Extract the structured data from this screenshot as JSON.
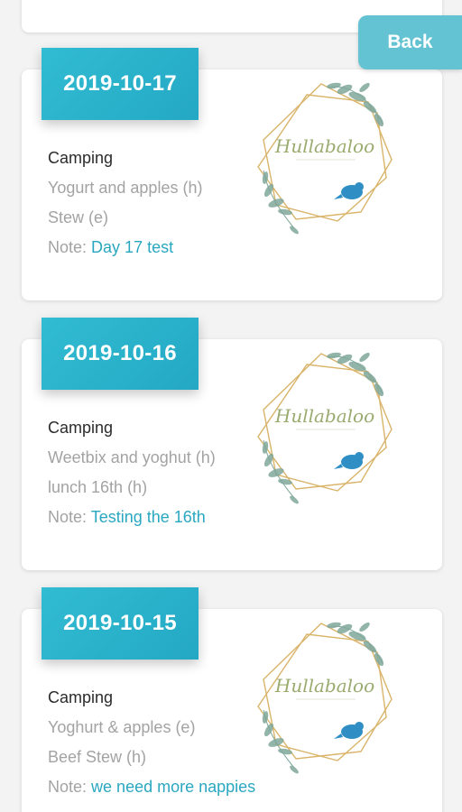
{
  "nav": {
    "back_label": "Back"
  },
  "entries": [
    {
      "date": "2019-10-17",
      "title": "Camping",
      "meals": [
        "Yogurt and apples (h)",
        "Stew (e)"
      ],
      "note_label": "Note:",
      "note_text": "Day 17 test",
      "logo_text": "Hullabaloo"
    },
    {
      "date": "2019-10-16",
      "title": "Camping",
      "meals": [
        "Weetbix and yoghut (h)",
        "lunch 16th (h)"
      ],
      "note_label": "Note:",
      "note_text": "Testing the 16th",
      "logo_text": "Hullabaloo"
    },
    {
      "date": "2019-10-15",
      "title": "Camping",
      "meals": [
        "Yoghurt & apples (e)",
        "Beef Stew (h)"
      ],
      "note_label": "Note:",
      "note_text": "we need more nappies",
      "logo_text": "Hullabaloo"
    }
  ],
  "colors": {
    "accent": "#2aa7c0",
    "badge": "#31bcd2",
    "back_button": "#63c3d3",
    "logo_gold": "#d9b46a",
    "logo_leaf": "#7fa79b",
    "logo_bird": "#2f8fc4"
  }
}
